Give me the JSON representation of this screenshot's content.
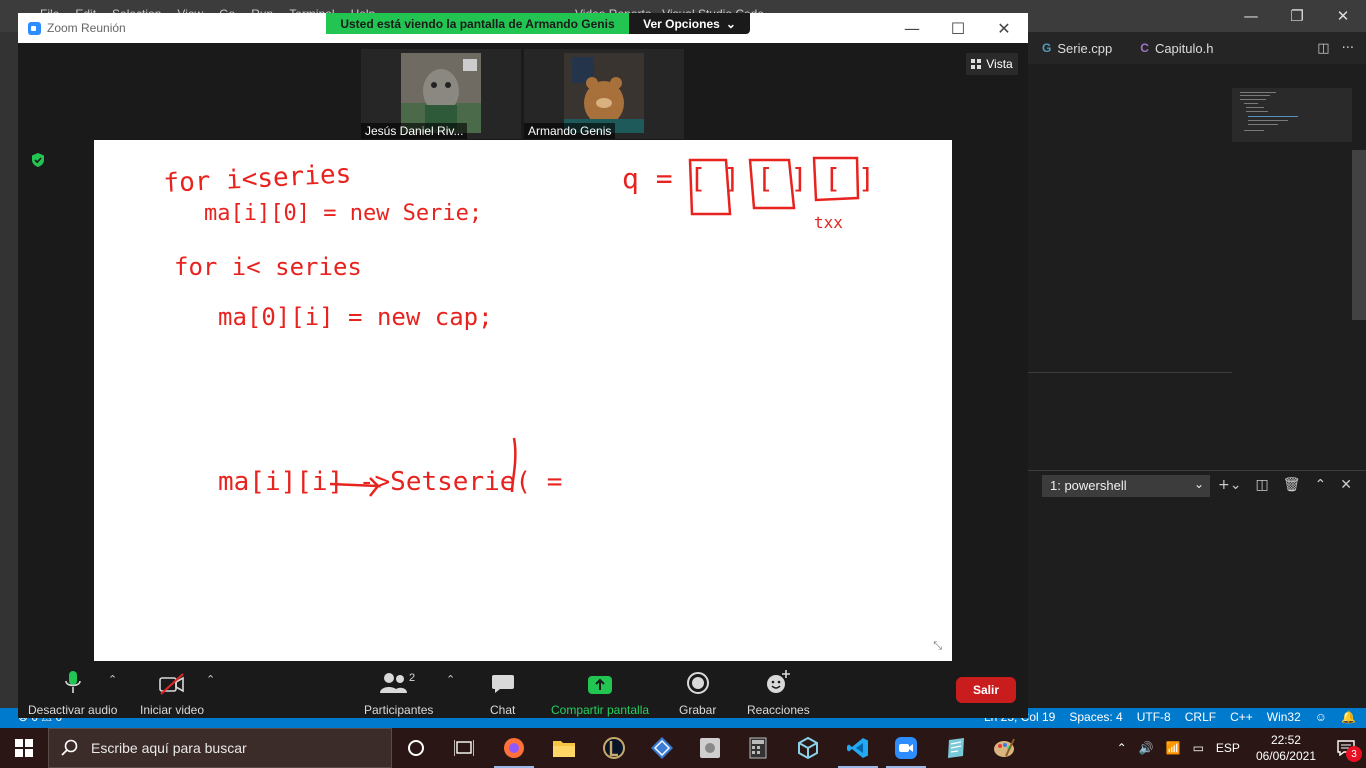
{
  "vscode": {
    "menu": [
      "File",
      "Edit",
      "Selection",
      "View",
      "Go",
      "Run",
      "Terminal",
      "Help"
    ],
    "window_title": "Video Reporte - Visual Studio Code",
    "tabs": [
      {
        "label": "Serie.cpp",
        "icon": "cpp-file-icon"
      },
      {
        "label": "Capitulo.h",
        "icon": "header-file-icon"
      }
    ],
    "terminal_select": "1: powershell",
    "status_left": "⊗ 0 ⚠ 0",
    "status_right": [
      "Ln 25, Col 19",
      "Spaces: 4",
      "UTF-8",
      "CRLF",
      "C++",
      "Win32"
    ]
  },
  "zoom": {
    "window_title": "Zoom Reunión",
    "share_banner": "Usted está viendo la pantalla de Armando Genis",
    "view_options": "Ver Opciones",
    "view_button": "Vista",
    "participants_tiles": [
      {
        "name": "Jesús Daniel Riv..."
      },
      {
        "name": "Armando Genis"
      }
    ],
    "toolbar": {
      "mute": "Desactivar audio",
      "video": "Iniciar video",
      "participants": "Participantes",
      "participants_count": "2",
      "chat": "Chat",
      "share": "Compartir pantalla",
      "record": "Grabar",
      "reactions": "Reacciones",
      "leave": "Salir"
    }
  },
  "whiteboard": {
    "handwriting_lines": [
      "for i<series",
      "ma[i][0] = new Serie;",
      "for i< series",
      "ma[0][i] = new cap;",
      "ma[i][i] ->Setserie( =",
      "q = [ ] [ ] [ ]",
      "txx"
    ]
  },
  "taskbar": {
    "search_placeholder": "Escribe aquí para buscar",
    "language": "ESP",
    "time": "22:52",
    "date": "06/06/2021",
    "notifications": "3"
  },
  "colors": {
    "zoom_green": "#23c552",
    "leave_red": "#c91d1d",
    "ink_red": "#e8231f",
    "vscode_blue": "#007acc"
  }
}
